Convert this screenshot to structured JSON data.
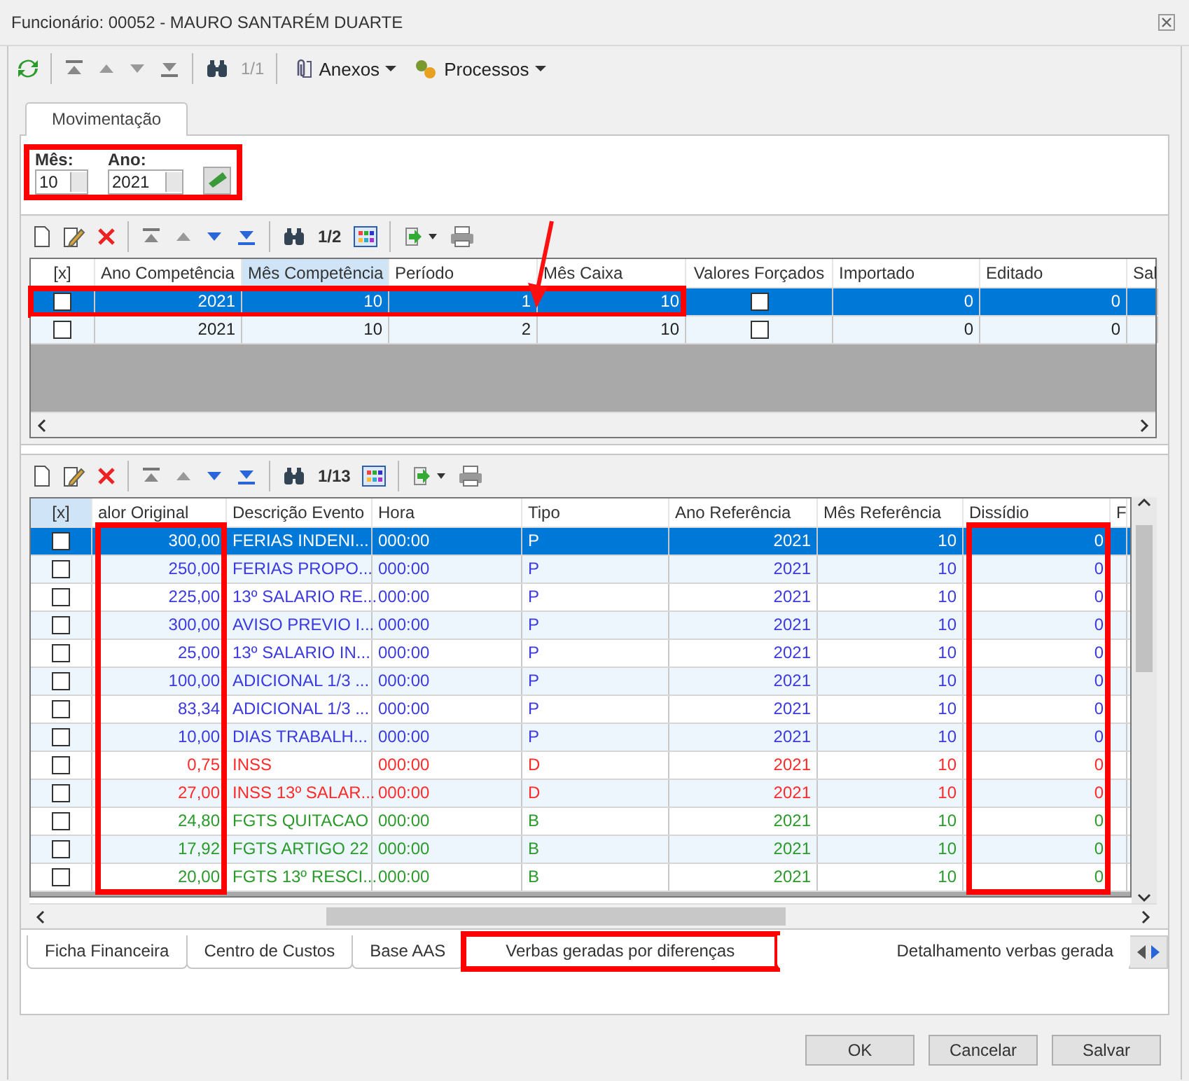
{
  "window": {
    "title": "Funcionário: 00052 - MAURO SANTARÉM DUARTE"
  },
  "toolbar": {
    "counter": "1/1",
    "menus": [
      "Anexos",
      "Processos"
    ]
  },
  "tabs": [
    {
      "label": "Movimentação",
      "selected": true
    }
  ],
  "period": {
    "highlighted": true,
    "fields": [
      {
        "label": "Mês:",
        "value": "10"
      },
      {
        "label": "Ano:",
        "value": "2021"
      }
    ]
  },
  "competencias": {
    "counter": "1/2",
    "columns": [
      {
        "label": "[x]",
        "kind": "check",
        "sorted": false
      },
      {
        "label": "Ano Competência",
        "kind": "number",
        "sorted": false
      },
      {
        "label": "Mês Competência",
        "kind": "number",
        "sorted": true
      },
      {
        "label": "Período",
        "kind": "number",
        "sorted": false
      },
      {
        "label": "Mês Caixa",
        "kind": "number",
        "sorted": false
      },
      {
        "label": "Valores Forçados",
        "kind": "check",
        "sorted": false
      },
      {
        "label": "Importado",
        "kind": "number",
        "sorted": false
      },
      {
        "label": "Editado",
        "kind": "number",
        "sorted": false
      },
      {
        "label": "Sal",
        "kind": "text",
        "sorted": false
      }
    ],
    "rows": [
      {
        "selected": true,
        "highlighted": true,
        "values": [
          false,
          "2021",
          "10",
          "1",
          "10",
          false,
          "0",
          "0"
        ]
      },
      {
        "selected": false,
        "highlighted": false,
        "values": [
          false,
          "2021",
          "10",
          "2",
          "10",
          false,
          "0",
          "0"
        ]
      }
    ]
  },
  "verbas": {
    "counter": "1/13",
    "columns": [
      {
        "label": "[x]",
        "kind": "check",
        "sorted": true,
        "highlighted": false
      },
      {
        "label": "alor Original",
        "kind": "number",
        "sorted": false,
        "highlighted": true
      },
      {
        "label": "Descrição Evento",
        "kind": "text",
        "sorted": false,
        "highlighted": false
      },
      {
        "label": "Hora",
        "kind": "text",
        "sorted": false,
        "highlighted": false
      },
      {
        "label": "Tipo",
        "kind": "text",
        "sorted": false,
        "highlighted": false
      },
      {
        "label": "Ano Referência",
        "kind": "number",
        "sorted": false,
        "highlighted": false
      },
      {
        "label": "Mês Referência",
        "kind": "number",
        "sorted": false,
        "highlighted": false
      },
      {
        "label": "Dissídio",
        "kind": "number",
        "sorted": false,
        "highlighted": true
      },
      {
        "label": "F",
        "kind": "text",
        "sorted": false,
        "highlighted": false
      }
    ],
    "rows": [
      {
        "selected": true,
        "values": [
          false,
          "300,00",
          "FERIAS INDENI...",
          "000:00",
          "P",
          "2021",
          "10",
          "0"
        ]
      },
      {
        "selected": false,
        "color": "#3a3ae0",
        "values": [
          false,
          "250,00",
          "FERIAS PROPO...",
          "000:00",
          "P",
          "2021",
          "10",
          "0"
        ]
      },
      {
        "selected": false,
        "color": "#3a3ae0",
        "values": [
          false,
          "225,00",
          "13º SALARIO RE...",
          "000:00",
          "P",
          "2021",
          "10",
          "0"
        ]
      },
      {
        "selected": false,
        "color": "#3a3ae0",
        "values": [
          false,
          "300,00",
          "AVISO PREVIO I...",
          "000:00",
          "P",
          "2021",
          "10",
          "0"
        ]
      },
      {
        "selected": false,
        "color": "#3a3ae0",
        "values": [
          false,
          "25,00",
          "13º SALARIO IN...",
          "000:00",
          "P",
          "2021",
          "10",
          "0"
        ]
      },
      {
        "selected": false,
        "color": "#3a3ae0",
        "values": [
          false,
          "100,00",
          "ADICIONAL 1/3 ...",
          "000:00",
          "P",
          "2021",
          "10",
          "0"
        ]
      },
      {
        "selected": false,
        "color": "#3a3ae0",
        "values": [
          false,
          "83,34",
          "ADICIONAL 1/3 ...",
          "000:00",
          "P",
          "2021",
          "10",
          "0"
        ]
      },
      {
        "selected": false,
        "color": "#3a3ae0",
        "values": [
          false,
          "10,00",
          "DIAS TRABALH...",
          "000:00",
          "P",
          "2021",
          "10",
          "0"
        ]
      },
      {
        "selected": false,
        "color": "#ff2a2a",
        "values": [
          false,
          "0,75",
          "INSS",
          "000:00",
          "D",
          "2021",
          "10",
          "0"
        ]
      },
      {
        "selected": false,
        "color": "#ff2a2a",
        "values": [
          false,
          "27,00",
          "INSS 13º SALAR...",
          "000:00",
          "D",
          "2021",
          "10",
          "0"
        ]
      },
      {
        "selected": false,
        "color": "#2a9a2a",
        "values": [
          false,
          "24,80",
          "FGTS QUITACAO",
          "000:00",
          "B",
          "2021",
          "10",
          "0"
        ]
      },
      {
        "selected": false,
        "color": "#2a9a2a",
        "values": [
          false,
          "17,92",
          "FGTS ARTIGO 22",
          "000:00",
          "B",
          "2021",
          "10",
          "0"
        ]
      },
      {
        "selected": false,
        "color": "#2a9a2a",
        "values": [
          false,
          "20,00",
          "FGTS 13º RESCI...",
          "000:00",
          "B",
          "2021",
          "10",
          "0"
        ]
      }
    ]
  },
  "bottom_tabs": [
    {
      "label": "Ficha Financeira",
      "selected": false,
      "highlighted": false
    },
    {
      "label": "Centro de Custos",
      "selected": false,
      "highlighted": false
    },
    {
      "label": "Base AAS",
      "selected": false,
      "highlighted": false
    },
    {
      "label": "Verbas geradas por diferenças",
      "selected": true,
      "highlighted": true
    },
    {
      "label": "Detalhamento verbas gerada",
      "selected": false,
      "highlighted": false
    }
  ],
  "buttons": [
    "OK",
    "Cancelar",
    "Salvar"
  ]
}
